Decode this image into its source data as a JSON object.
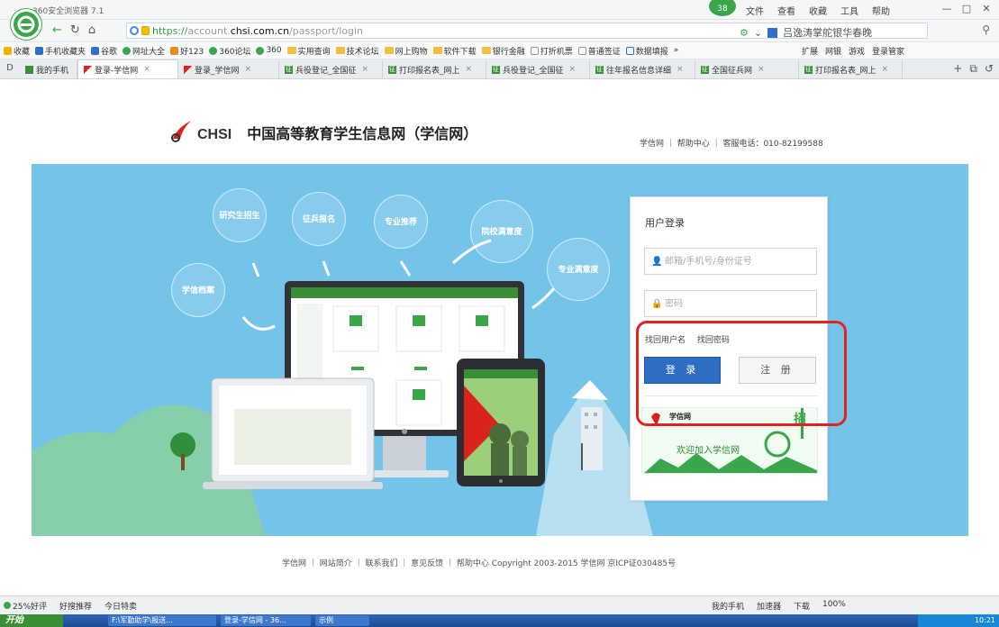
{
  "browser": {
    "title": "360安全浏览器 7.1",
    "badge": "38",
    "menus": [
      "文件",
      "查看",
      "收藏",
      "工具",
      "帮助"
    ],
    "url_scheme": "https://",
    "url_host_prefix": "account.",
    "url_host": "chsi.com.cn",
    "url_path": "/passport/login",
    "search_placeholder": "吕逸涛掌舵银华春晚"
  },
  "bookmarks": {
    "items": [
      "收藏",
      "手机收藏夹",
      "谷歌",
      "网址大全",
      "好123",
      "360论坛",
      "360",
      "实用查询",
      "技术论坛",
      "网上购物",
      "软件下载",
      "银行金融",
      "打折机票",
      "普通签证",
      "数据填报"
    ],
    "more": "»",
    "right_items": [
      "扩展",
      "网银",
      "游戏",
      "登录管家"
    ]
  },
  "tabs": [
    {
      "label": "我的手机",
      "active": false
    },
    {
      "label": "登录-学信网",
      "active": true
    },
    {
      "label": "登录_学信网",
      "active": false
    },
    {
      "label": "兵役登记_全国征",
      "active": false
    },
    {
      "label": "打印报名表_网上",
      "active": false
    },
    {
      "label": "兵役登记_全国征",
      "active": false
    },
    {
      "label": "往年报名信息详细",
      "active": false
    },
    {
      "label": "全国征兵网",
      "active": false
    },
    {
      "label": "打印报名表_网上",
      "active": false
    }
  ],
  "site": {
    "logo_text": "CHSI",
    "name": "中国高等教育学生信息网（学信网）",
    "header_links": "学信网 ｜ 帮助中心 ｜ 客服电话：010-82199588",
    "bubbles": [
      "研究生招生",
      "征兵报名",
      "专业推荐",
      "院校满意度",
      "专业满意度",
      "学信档案"
    ],
    "footer": "学信网  ｜  网站简介  ｜  联系我们  ｜  意见反馈  ｜  帮助中心     Copyright 2003-2015 学信网 京ICP证030485号"
  },
  "login": {
    "title": "用户登录",
    "username_placeholder": "邮箱/手机号/身份证号",
    "password_placeholder": "密码",
    "forgot_username": "找回用户名",
    "forgot_password": "找回密码",
    "login_button": "登 录",
    "register_button": "注 册",
    "ad_logo": "学信网",
    "ad_text": "欢迎加入学信网",
    "ad_side": "招"
  },
  "statusbar": {
    "left": [
      "25%好评",
      "好搜推荐",
      "今日特卖"
    ],
    "right": [
      "我的手机",
      "加速器",
      "下载",
      "100%"
    ]
  },
  "taskbar": {
    "start": "开始",
    "tasks": [
      "F:\\军勤助学\\报送...",
      "登录-学信网 - 36...",
      "示例"
    ],
    "clock": "10:21"
  },
  "colors": {
    "hero_bg": "#74c4ea",
    "login_button": "#2e6dc4",
    "highlight": "#e32222",
    "brand_green": "#3aa64a"
  }
}
